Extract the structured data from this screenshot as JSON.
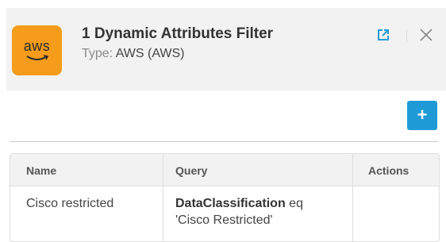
{
  "header": {
    "logo_text": "aws",
    "title": "1 Dynamic Attributes Filter",
    "type_label": "Type:",
    "type_value": "AWS (AWS)"
  },
  "toolbar": {
    "add_label": "+"
  },
  "table": {
    "columns": [
      "Name",
      "Query",
      "Actions"
    ],
    "rows": [
      {
        "name": "Cisco restricted",
        "query_key": "DataClassification",
        "query_op": " eq",
        "query_value": "'Cisco Restricted'",
        "actions": ""
      }
    ]
  },
  "colors": {
    "aws_orange": "#f59c1a",
    "accent_blue": "#1e9bd7",
    "header_bg": "#f2f2f2"
  },
  "icons": [
    "external-link-icon",
    "close-icon",
    "add-icon"
  ]
}
